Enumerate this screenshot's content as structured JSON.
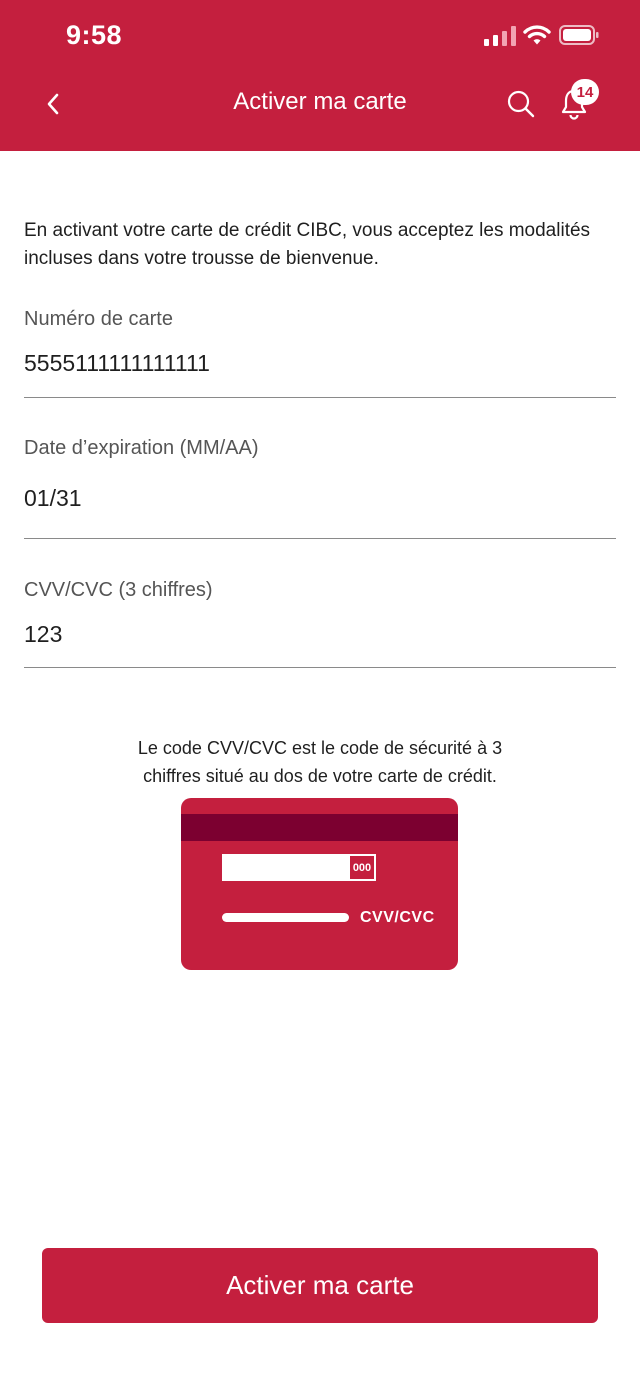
{
  "status_bar": {
    "time": "9:58"
  },
  "nav": {
    "title": "Activer ma carte",
    "notification_count": "14"
  },
  "intro_text": "En activant votre carte de crédit CIBC, vous acceptez les modalités incluses dans votre trousse de bienvenue.",
  "fields": [
    {
      "label": "Numéro de carte",
      "value": "5555111111111111"
    },
    {
      "label": "Date d’expiration (MM/AA)",
      "value": "01/31"
    },
    {
      "label": "CVV/CVC (3 chiffres)",
      "value": "123"
    }
  ],
  "cvv_help": {
    "line1": "Le code CVV/CVC est le code de sécurité à 3",
    "line2": "chiffres situé au dos de votre carte de crédit.",
    "card_code": "000",
    "card_label": "CVV/CVC"
  },
  "primary_button": {
    "label": "Activer ma carte"
  },
  "colors": {
    "brand_red": "#c41f3e",
    "stripe": "#7c0030"
  },
  "icons": [
    "chevron-left-icon",
    "search-icon",
    "bell-icon",
    "signal-icon",
    "wifi-icon",
    "battery-icon"
  ]
}
